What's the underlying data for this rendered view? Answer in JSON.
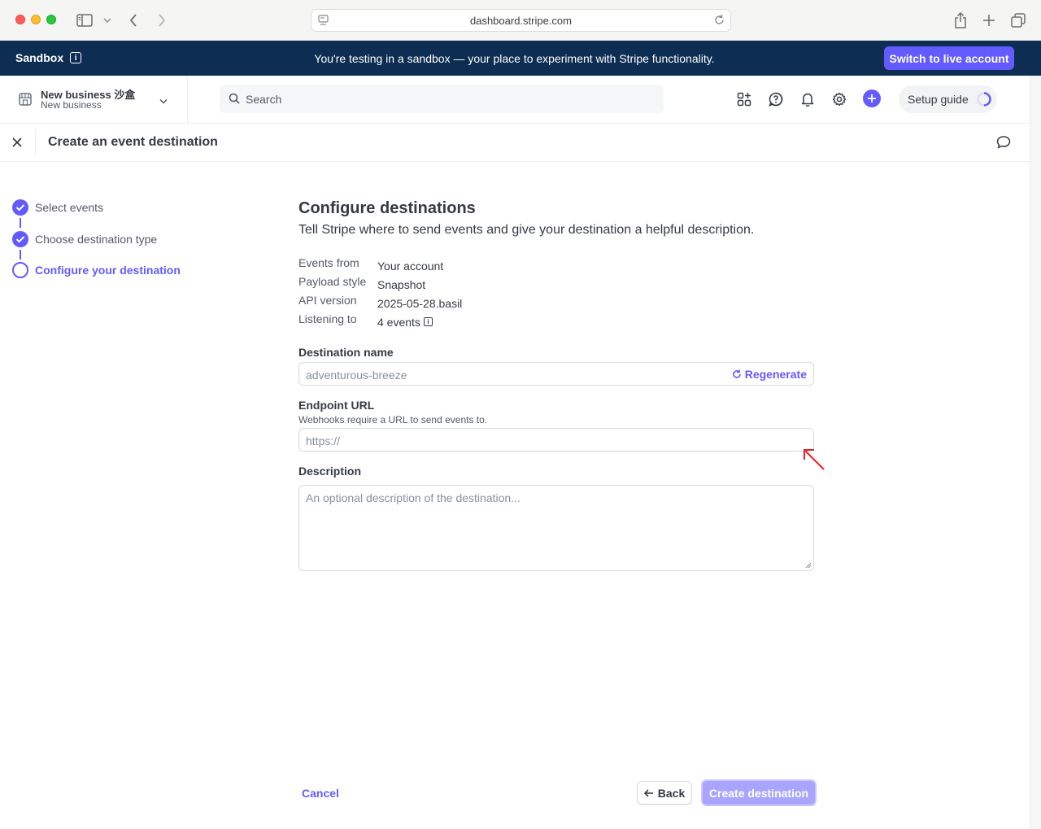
{
  "browser": {
    "url": "dashboard.stripe.com"
  },
  "banner": {
    "label": "Sandbox",
    "message": "You're testing in a sandbox — your place to experiment with Stripe functionality.",
    "switch_button": "Switch to live account"
  },
  "header": {
    "account_name": "New business 沙盒",
    "account_sub": "New business",
    "search_placeholder": "Search",
    "setup_guide": "Setup guide"
  },
  "titlebar": {
    "title": "Create an event destination"
  },
  "stepper": {
    "steps": [
      {
        "label": "Select events",
        "state": "done"
      },
      {
        "label": "Choose destination type",
        "state": "done"
      },
      {
        "label": "Configure your destination",
        "state": "current"
      }
    ]
  },
  "main": {
    "title": "Configure destinations",
    "subtitle": "Tell Stripe where to send events and give your destination a helpful description.",
    "details": [
      {
        "key": "Events from",
        "value": "Your account"
      },
      {
        "key": "Payload style",
        "value": "Snapshot"
      },
      {
        "key": "API version",
        "value": "2025-05-28.basil"
      },
      {
        "key": "Listening to",
        "value": "4 events"
      }
    ],
    "destination_name": {
      "label": "Destination name",
      "placeholder": "adventurous-breeze",
      "regenerate": "Regenerate"
    },
    "endpoint_url": {
      "label": "Endpoint URL",
      "help": "Webhooks require a URL to send events to.",
      "placeholder": "https://"
    },
    "description": {
      "label": "Description",
      "placeholder": "An optional description of the destination..."
    }
  },
  "footer": {
    "cancel": "Cancel",
    "back": "Back",
    "create": "Create destination"
  },
  "colors": {
    "accent": "#635bff",
    "banner_bg": "#0d2d52",
    "annotation_arrow": "#e8202a"
  }
}
